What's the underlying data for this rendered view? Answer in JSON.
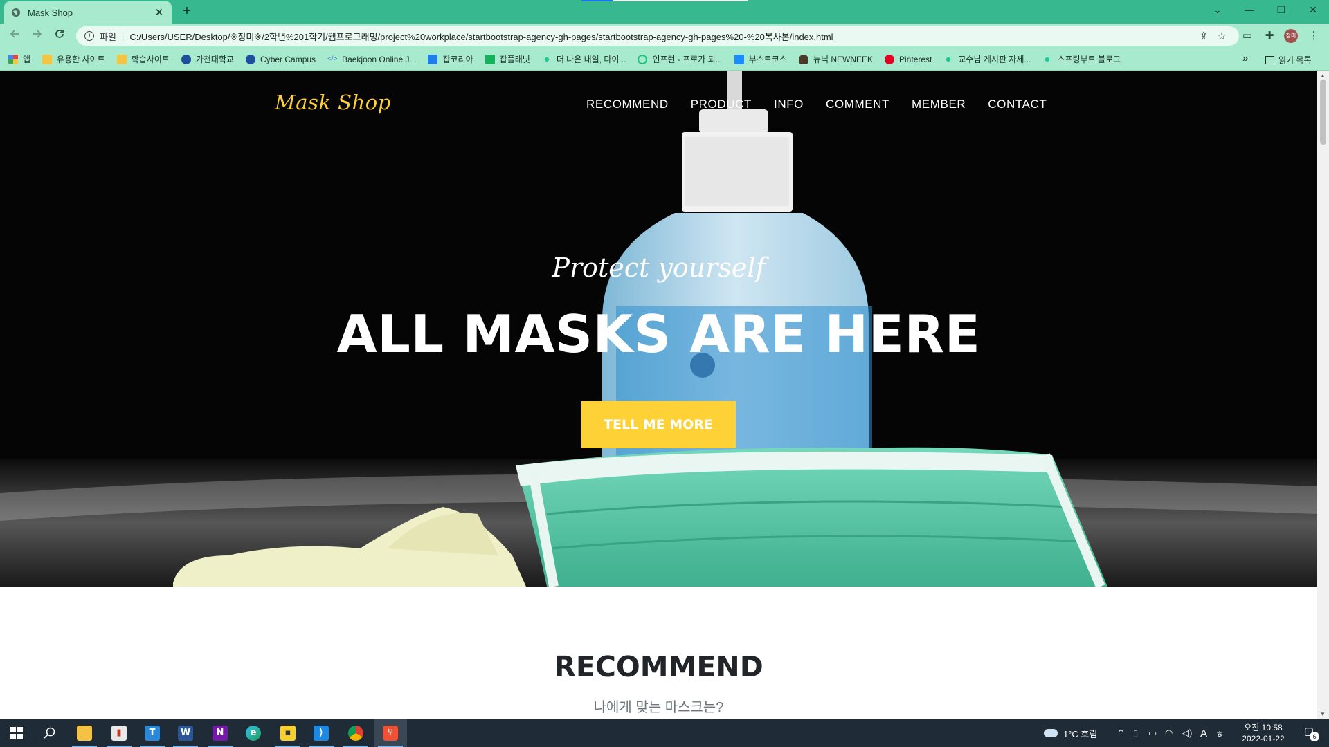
{
  "browser": {
    "tab_title": "Mask Shop",
    "tab_close": "✕",
    "new_tab": "+",
    "window_controls": [
      "⌄",
      "—",
      "❐",
      "✕"
    ],
    "scheme_label": "파일",
    "url": "C:/Users/USER/Desktop/※정미※/2학년%201학기/웹프로그래밍/project%20workplace/startbootstrap-agency-gh-pages/startbootstrap-agency-gh-pages%20-%20복사본/index.html",
    "avatar_text": "정미",
    "bookmarks": [
      {
        "label": "앱",
        "icon": "apps-icon",
        "color": "#e8453c"
      },
      {
        "label": "유용한 사이트",
        "icon": "folder-icon",
        "color": "#f4c542"
      },
      {
        "label": "학습사이트",
        "icon": "folder-icon",
        "color": "#f4c542"
      },
      {
        "label": "가천대학교",
        "icon": "gachon-icon",
        "color": "#1c4f9c"
      },
      {
        "label": "Cyber Campus",
        "icon": "gachon-icon",
        "color": "#1c4f9c"
      },
      {
        "label": "Baekjoon Online J...",
        "icon": "code-icon",
        "color": "#4a7fd0"
      },
      {
        "label": "잡코리아",
        "icon": "jobkorea-icon",
        "color": "#1f7ee8"
      },
      {
        "label": "잡플래닛",
        "icon": "jobplanet-icon",
        "color": "#13b25b"
      },
      {
        "label": "더 나은 내일, 다이...",
        "icon": "velog-icon",
        "color": "#20c997"
      },
      {
        "label": "인프런 - 프로가 되...",
        "icon": "inflearn-icon",
        "color": "#1dc078"
      },
      {
        "label": "부스트코스",
        "icon": "boostcourse-icon",
        "color": "#1a8cff"
      },
      {
        "label": "뉴닉 NEWNEEK",
        "icon": "newneek-icon",
        "color": "#4a3a2a"
      },
      {
        "label": "Pinterest",
        "icon": "pinterest-icon",
        "color": "#e60023"
      },
      {
        "label": "교수님 게시판 자세...",
        "icon": "velog-icon",
        "color": "#20c997"
      },
      {
        "label": "스프링부트 블로그",
        "icon": "velog-icon",
        "color": "#20c997"
      }
    ],
    "bookmarks_more": "»",
    "reading_list": "읽기 목록"
  },
  "site": {
    "brand": "Mask Shop",
    "nav": [
      "RECOMMEND",
      "PRODUCT",
      "INFO",
      "COMMENT",
      "MEMBER",
      "CONTACT"
    ],
    "hero_subheading": "Protect yourself",
    "hero_heading": "ALL MASKS ARE HERE",
    "hero_button": "TELL ME MORE",
    "section_heading": "RECOMMEND",
    "section_subheading": "나에게 맞는 마스크는?",
    "colors": {
      "accent": "#fed136",
      "hero_bg": "#050505",
      "mask": "#5dcfae"
    }
  },
  "taskbar": {
    "weather": "1°C  흐림",
    "clock_time": "오전 10:58",
    "clock_date": "2022-01-22",
    "notification_count": "6",
    "ime_label": "A",
    "apps": [
      "start",
      "search",
      "file-explorer",
      "app",
      "teams",
      "word",
      "onenote",
      "edge",
      "sticky-notes",
      "vscode",
      "chrome",
      "git"
    ]
  }
}
